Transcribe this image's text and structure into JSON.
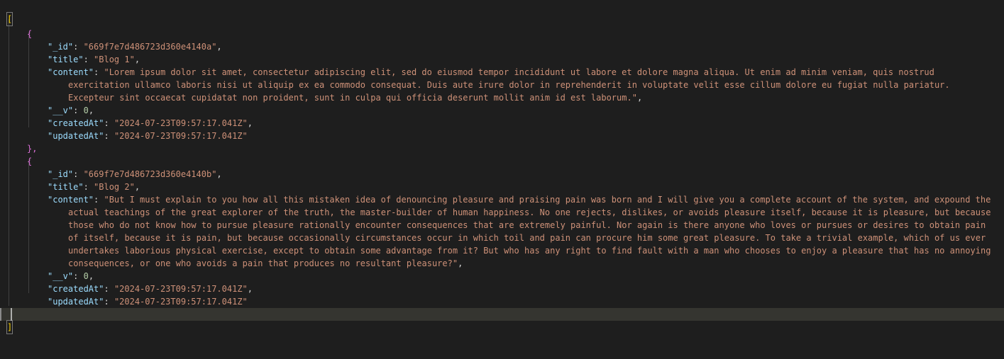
{
  "editor": {
    "language": "json",
    "colors": {
      "background": "#1e1e1e",
      "key": "#9cdcfe",
      "string": "#ce9178",
      "number": "#b5cea8",
      "punctuation": "#d4d4d4",
      "bracket_outer": "#ffd700",
      "bracket_inner": "#da70d6",
      "current_line": "#353530"
    },
    "brackets": {
      "open_array": "[",
      "close_array": "]",
      "open_object": "{",
      "close_object": "}",
      "close_object_comma": "},"
    },
    "docs": [
      {
        "id_key": "\"_id\"",
        "id_value": "\"669f7e7d486723d360e4140a\"",
        "title_key": "\"title\"",
        "title_value": "\"Blog 1\"",
        "content_key": "\"content\"",
        "content_lines": [
          "\"Lorem ipsum dolor sit amet, consectetur adipiscing elit, sed do eiusmod tempor incididunt ut labore et dolore magna aliqua. Ut enim ad minim veniam, quis nostrud",
          "exercitation ullamco laboris nisi ut aliquip ex ea commodo consequat. Duis aute irure dolor in reprehenderit in voluptate velit esse cillum dolore eu fugiat nulla pariatur.",
          "Excepteur sint occaecat cupidatat non proident, sunt in culpa qui officia deserunt mollit anim id est laborum.\""
        ],
        "v_key": "\"__v\"",
        "v_value": "0",
        "created_key": "\"createdAt\"",
        "created_value": "\"2024-07-23T09:57:17.041Z\"",
        "updated_key": "\"updatedAt\"",
        "updated_value": "\"2024-07-23T09:57:17.041Z\""
      },
      {
        "id_key": "\"_id\"",
        "id_value": "\"669f7e7d486723d360e4140b\"",
        "title_key": "\"title\"",
        "title_value": "\"Blog 2\"",
        "content_key": "\"content\"",
        "content_lines": [
          "\"But I must explain to you how all this mistaken idea of denouncing pleasure and praising pain was born and I will give you a complete account of the system, and expound the",
          "actual teachings of the great explorer of the truth, the master-builder of human happiness. No one rejects, dislikes, or avoids pleasure itself, because it is pleasure, but because",
          "those who do not know how to pursue pleasure rationally encounter consequences that are extremely painful. Nor again is there anyone who loves or pursues or desires to obtain pain",
          "of itself, because it is pain, but because occasionally circumstances occur in which toil and pain can procure him some great pleasure. To take a trivial example, which of us ever",
          "undertakes laborious physical exercise, except to obtain some advantage from it? But who has any right to find fault with a man who chooses to enjoy a pleasure that has no annoying",
          "consequences, or one who avoids a pain that produces no resultant pleasure?\""
        ],
        "v_key": "\"__v\"",
        "v_value": "0",
        "created_key": "\"createdAt\"",
        "created_value": "\"2024-07-23T09:57:17.041Z\"",
        "updated_key": "\"updatedAt\"",
        "updated_value": "\"2024-07-23T09:57:17.041Z\""
      }
    ]
  }
}
